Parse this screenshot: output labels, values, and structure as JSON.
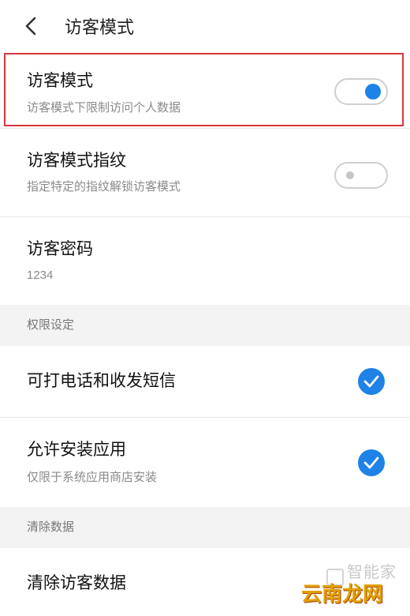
{
  "header": {
    "title": "访客模式"
  },
  "guest_mode": {
    "title": "访客模式",
    "subtitle": "访客模式下限制访问个人数据",
    "enabled": true
  },
  "fingerprint": {
    "title": "访客模式指纹",
    "subtitle": "指定特定的指纹解锁访客模式",
    "enabled": false
  },
  "password": {
    "title": "访客密码",
    "value": "1234"
  },
  "permissions": {
    "section_label": "权限设定",
    "items": [
      {
        "title": "可打电话和收发短信",
        "checked": true
      },
      {
        "title": "允许安装应用",
        "subtitle": "仅限于系统应用商店安装",
        "checked": true
      }
    ]
  },
  "clear": {
    "section_label": "清除数据",
    "title": "清除访客数据"
  },
  "watermark": {
    "text": "智能家",
    "site": "云南龙网"
  },
  "colors": {
    "accent": "#1e82e6",
    "highlight": "#d9363e",
    "section_bg": "#f3f3f3"
  }
}
